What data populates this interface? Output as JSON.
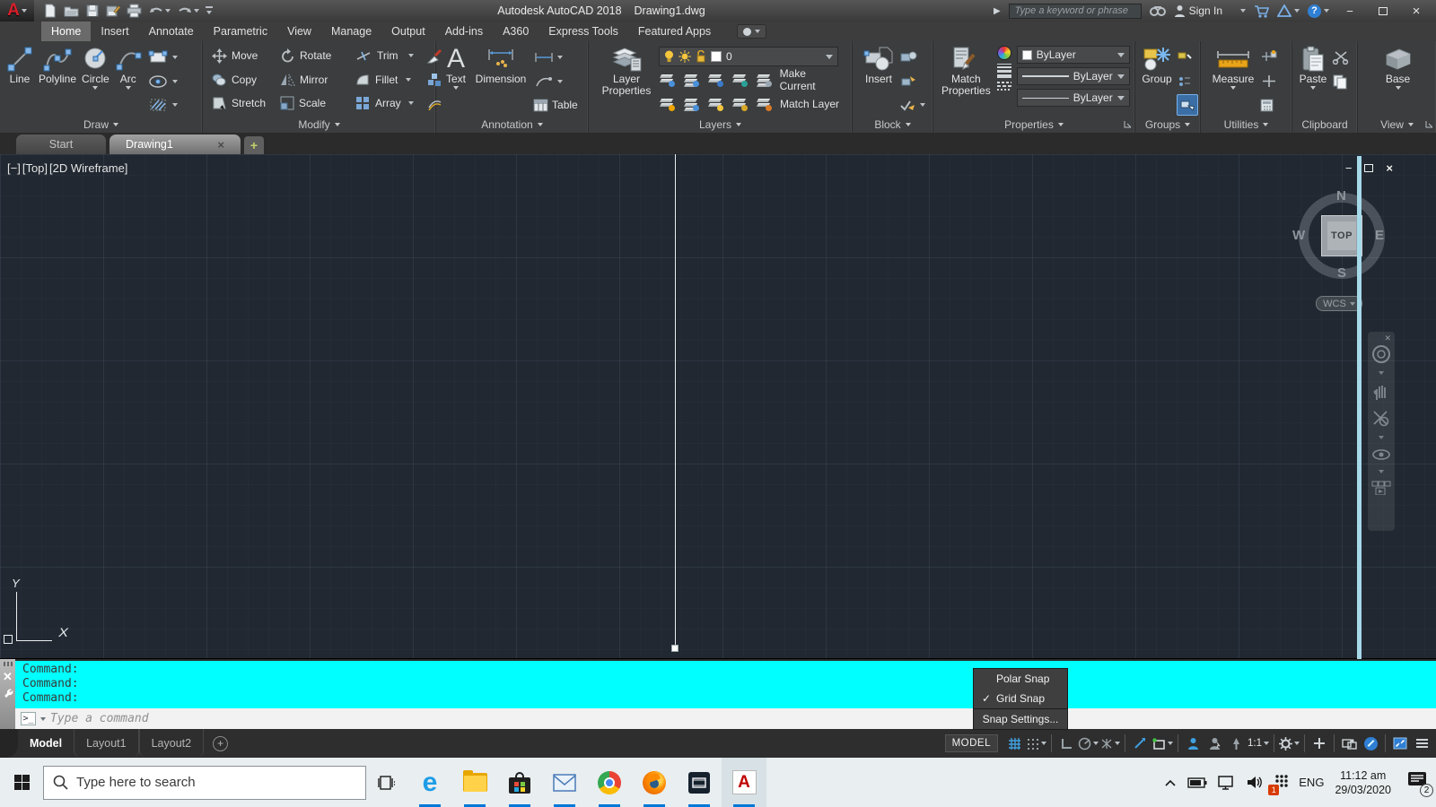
{
  "titlebar": {
    "app_title": "Autodesk AutoCAD 2018",
    "doc_title": "Drawing1.dwg",
    "search_placeholder": "Type a keyword or phrase",
    "sign_in": "Sign In"
  },
  "ribbon": {
    "tabs": [
      {
        "label": "Home",
        "active": true
      },
      {
        "label": "Insert"
      },
      {
        "label": "Annotate"
      },
      {
        "label": "Parametric"
      },
      {
        "label": "View"
      },
      {
        "label": "Manage"
      },
      {
        "label": "Output"
      },
      {
        "label": "Add-ins"
      },
      {
        "label": "A360"
      },
      {
        "label": "Express Tools"
      },
      {
        "label": "Featured Apps"
      }
    ],
    "draw": {
      "label": "Draw",
      "line": "Line",
      "polyline": "Polyline",
      "circle": "Circle",
      "arc": "Arc"
    },
    "modify": {
      "label": "Modify",
      "move": "Move",
      "rotate": "Rotate",
      "trim": "Trim",
      "copy": "Copy",
      "mirror": "Mirror",
      "fillet": "Fillet",
      "stretch": "Stretch",
      "scale": "Scale",
      "array": "Array"
    },
    "annotation": {
      "label": "Annotation",
      "text": "Text",
      "dimension": "Dimension",
      "table": "Table"
    },
    "layers": {
      "label": "Layers",
      "layer_properties": "Layer Properties",
      "current_layer": "0",
      "make_current": "Make Current",
      "match_layer": "Match Layer"
    },
    "block": {
      "label": "Block",
      "insert": "Insert"
    },
    "properties": {
      "label": "Properties",
      "match_properties": "Match Properties",
      "color": "ByLayer",
      "lineweight": "ByLayer",
      "linetype": "ByLayer"
    },
    "groups": {
      "label": "Groups",
      "group": "Group"
    },
    "utilities": {
      "label": "Utilities",
      "measure": "Measure"
    },
    "clipboard": {
      "label": "Clipboard",
      "paste": "Paste"
    },
    "view": {
      "label": "View",
      "base": "Base"
    }
  },
  "file_tabs": {
    "start": "Start",
    "drawing1": "Drawing1"
  },
  "viewport": {
    "control_minus": "[−]",
    "control_view": "[Top]",
    "control_style": "[2D Wireframe]",
    "viewcube": {
      "n": "N",
      "s": "S",
      "e": "E",
      "w": "W",
      "top": "TOP",
      "wcs": "WCS"
    },
    "ucs": {
      "x": "X",
      "y": "Y"
    }
  },
  "command": {
    "history": [
      "Command:",
      "Command:",
      "Command:"
    ],
    "prompt": ">_",
    "placeholder": "Type a command"
  },
  "snap_menu": {
    "check": "✓",
    "polar": "Polar Snap",
    "grid": "Grid Snap",
    "settings": "Snap Settings..."
  },
  "status": {
    "model_tab": "Model",
    "layout1": "Layout1",
    "layout2": "Layout2",
    "plus": "+",
    "model_badge": "MODEL",
    "scale": "1:1"
  },
  "taskbar": {
    "search_placeholder": "Type here to search",
    "language": "ENG",
    "time": "11:12 am",
    "date": "29/03/2020",
    "notification_count": "2",
    "app_badge": "1"
  },
  "glyphs": {
    "acad_letter": "A",
    "edge_letter": "e",
    "close": "×",
    "minimize": "−",
    "plus": "+"
  },
  "colors": {
    "command_history_bg": "#00ffff",
    "canvas_bg": "#212831",
    "taskbar_accent": "#0078d7",
    "autocad_red": "#d5202a",
    "ribbon_bg": "#3b3d3e"
  }
}
